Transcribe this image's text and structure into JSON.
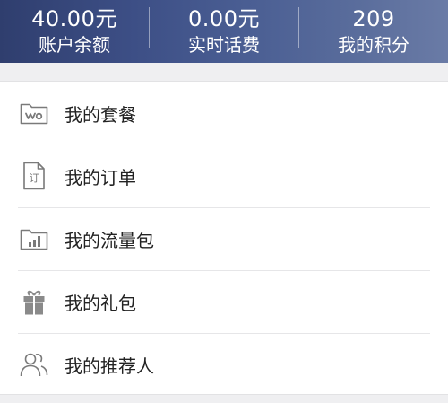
{
  "stats": {
    "balance": {
      "value": "40.00元",
      "label": "账户余额"
    },
    "realtime_fee": {
      "value": "0.00元",
      "label": "实时话费"
    },
    "points": {
      "value": "209",
      "label": "我的积分"
    }
  },
  "menu": {
    "items": [
      {
        "label": "我的套餐",
        "icon": "plan-folder-icon"
      },
      {
        "label": "我的订单",
        "icon": "order-document-icon"
      },
      {
        "label": "我的流量包",
        "icon": "data-package-icon"
      },
      {
        "label": "我的礼包",
        "icon": "gift-icon"
      },
      {
        "label": "我的推荐人",
        "icon": "referrer-people-icon"
      }
    ]
  },
  "colors": {
    "header_gradient_start": "#2f3e6e",
    "header_gradient_end": "#6a7ba6",
    "icon": "#7a7a7a",
    "text": "#222222"
  }
}
